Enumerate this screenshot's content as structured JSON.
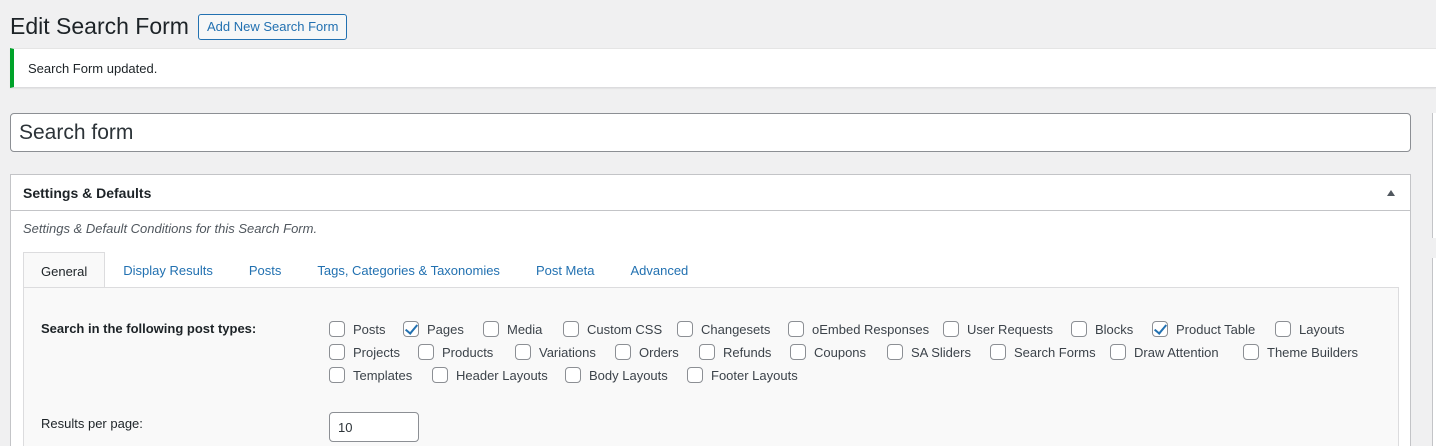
{
  "header": {
    "title": "Edit Search Form",
    "add_new_label": "Add New Search Form"
  },
  "notice": {
    "text": "Search Form updated."
  },
  "title_field": {
    "value": "Search form"
  },
  "settings_box": {
    "title": "Settings & Defaults",
    "intro": "Settings & Default Conditions for this Search Form.",
    "tabs": [
      "General",
      "Display Results",
      "Posts",
      "Tags, Categories & Taxonomies",
      "Post Meta",
      "Advanced"
    ],
    "active_tab": "General"
  },
  "general": {
    "post_types_label": "Search in the following post types:",
    "post_types": [
      {
        "label": "Posts",
        "checked": false
      },
      {
        "label": "Pages",
        "checked": true
      },
      {
        "label": "Media",
        "checked": false
      },
      {
        "label": "Custom CSS",
        "checked": false
      },
      {
        "label": "Changesets",
        "checked": false
      },
      {
        "label": "oEmbed Responses",
        "checked": false
      },
      {
        "label": "User Requests",
        "checked": false
      },
      {
        "label": "Blocks",
        "checked": false
      },
      {
        "label": "Product Table",
        "checked": true
      },
      {
        "label": "Layouts",
        "checked": false
      },
      {
        "label": "Projects",
        "checked": false
      },
      {
        "label": "Products",
        "checked": false
      },
      {
        "label": "Variations",
        "checked": false
      },
      {
        "label": "Orders",
        "checked": false
      },
      {
        "label": "Refunds",
        "checked": false
      },
      {
        "label": "Coupons",
        "checked": false
      },
      {
        "label": "SA Sliders",
        "checked": false
      },
      {
        "label": "Search Forms",
        "checked": false
      },
      {
        "label": "Draw Attention",
        "checked": false
      },
      {
        "label": "Theme Builders",
        "checked": false
      },
      {
        "label": "Templates",
        "checked": false
      },
      {
        "label": "Header Layouts",
        "checked": false
      },
      {
        "label": "Body Layouts",
        "checked": false
      },
      {
        "label": "Footer Layouts",
        "checked": false
      }
    ],
    "results_per_page_label": "Results per page:",
    "results_per_page_value": "10"
  }
}
